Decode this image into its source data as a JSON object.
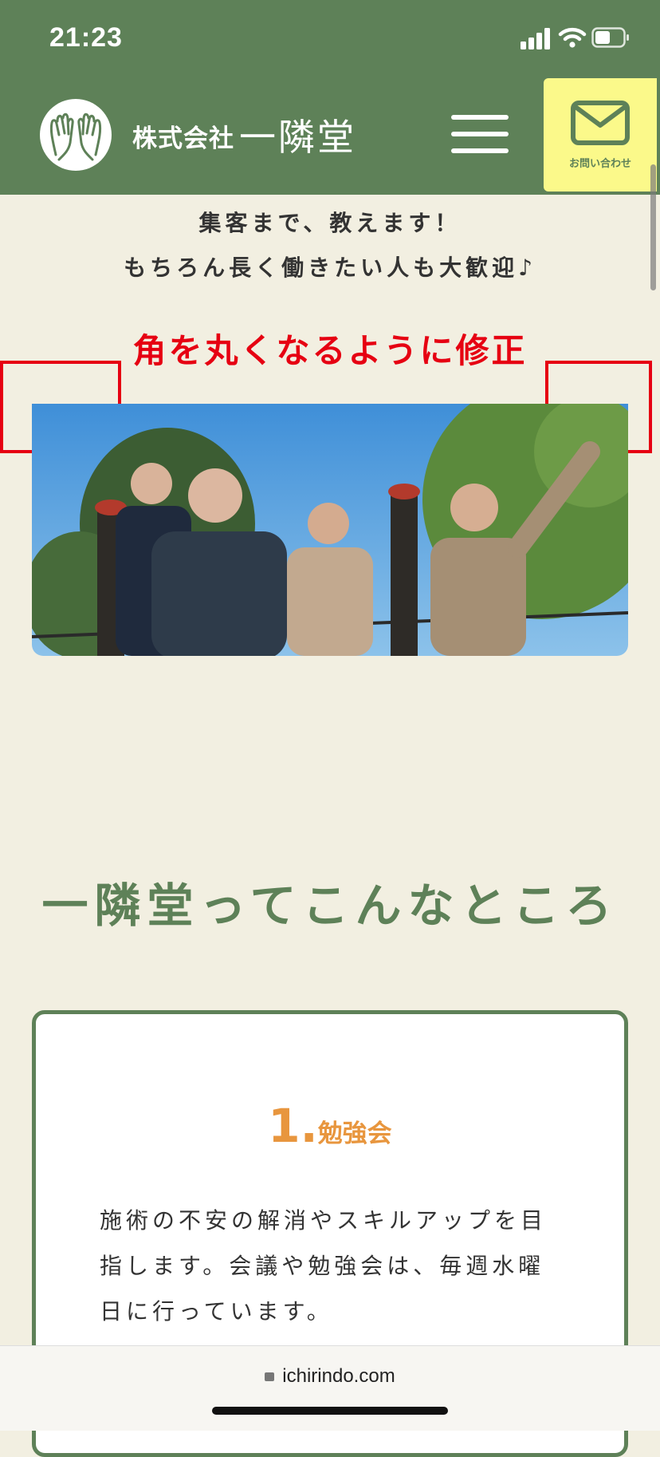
{
  "status": {
    "time": "21:23"
  },
  "header": {
    "company": "株式会社",
    "brand": "一隣堂",
    "menu_icon": "hamburger-icon",
    "contact_icon": "envelope-icon",
    "contact_label": "お問い合わせ"
  },
  "intro": {
    "line1": "集客まで、教えます！",
    "line2": "もちろん長く働きたい人も大歓迎♪"
  },
  "annotation": {
    "text": "角を丸くなるように修正"
  },
  "section": {
    "title": "一隣堂ってこんなところ"
  },
  "card": {
    "number": "1.",
    "heading": "勉強会",
    "body": "施術の不安の解消やスキルアップを目指します。会議や勉強会は、毎週水曜日に行っています。"
  },
  "browser": {
    "url": "ichirindo.com"
  },
  "colors": {
    "brand_green": "#5e8158",
    "background": "#f2efe1",
    "contact_yellow": "#fbf98a",
    "accent_orange": "#e8963e",
    "annotation_red": "#e60012"
  }
}
